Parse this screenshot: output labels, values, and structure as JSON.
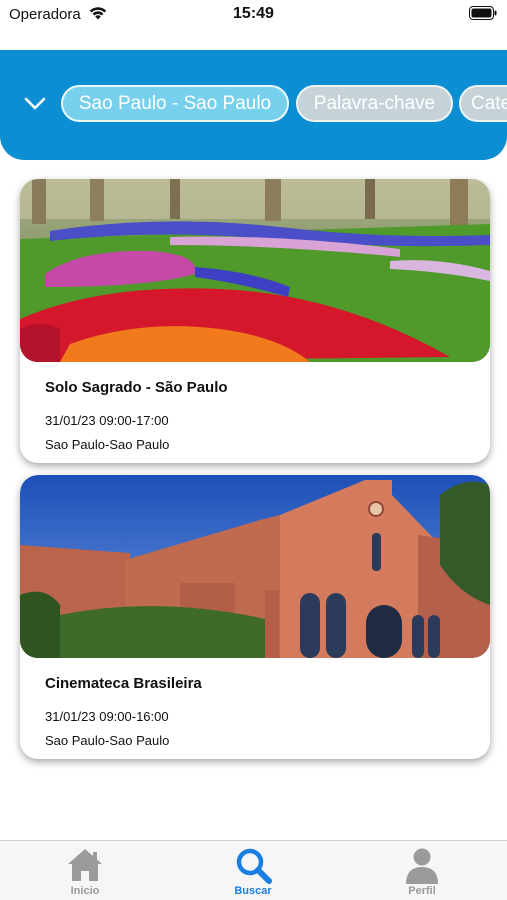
{
  "status_bar": {
    "carrier": "Operadora",
    "time": "15:49",
    "icons": [
      "wifi-icon",
      "battery-icon"
    ]
  },
  "filters": {
    "toggle_icon": "chevron-down-icon",
    "chips": [
      {
        "label": "Sao Paulo - Sao Paulo",
        "state": "selected"
      },
      {
        "label": "Palavra-chave",
        "state": "inactive"
      },
      {
        "label": "Cate",
        "state": "inactive"
      }
    ]
  },
  "events": [
    {
      "title": "Solo Sagrado - São Paulo",
      "datetime": "31/01/23 09:00-17:00",
      "location": "Sao Paulo-Sao Paulo"
    },
    {
      "title": "Cinemateca Brasileira",
      "datetime": "31/01/23 09:00-16:00",
      "location": "Sao Paulo-Sao Paulo"
    }
  ],
  "tabs": [
    {
      "label": "Inicio",
      "icon": "home-icon",
      "active": false
    },
    {
      "label": "Buscar",
      "icon": "search-icon",
      "active": true
    },
    {
      "label": "Perfil",
      "icon": "user-icon",
      "active": false
    }
  ],
  "colors": {
    "header": "#0c8ed3",
    "chip_selected": "#77d1ec",
    "chip_inactive": "#c6d2d8",
    "tab_active": "#1a7fe0",
    "tab_inactive": "#9b9b9b"
  }
}
